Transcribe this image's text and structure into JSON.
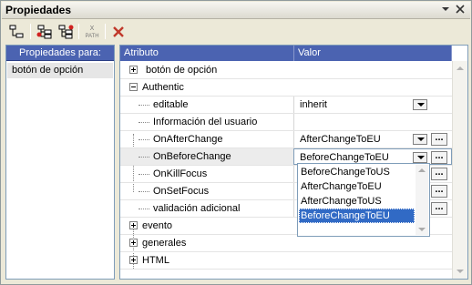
{
  "window": {
    "title": "Propiedades"
  },
  "left_panel": {
    "header": "Propiedades para:",
    "items": [
      "botón de opción"
    ]
  },
  "columns": {
    "attribute": "Atributo",
    "value": "Valor"
  },
  "rows": [
    {
      "label": "botón de opción",
      "expander": "plus"
    },
    {
      "label": "Authentic",
      "expander": "minus"
    },
    {
      "label": "editable",
      "value": "inherit"
    },
    {
      "label": "Información del usuario"
    },
    {
      "label": "OnAfterChange",
      "value": "AfterChangeToEU"
    },
    {
      "label": "OnBeforeChange",
      "value": "BeforeChangeToEU"
    },
    {
      "label": "OnKillFocus"
    },
    {
      "label": "OnSetFocus"
    },
    {
      "label": "validación adicional"
    },
    {
      "label": "evento",
      "expander": "plus"
    },
    {
      "label": "generales",
      "expander": "plus"
    },
    {
      "label": "HTML",
      "expander": "plus"
    }
  ],
  "more_label": "...",
  "dropdown": {
    "options": [
      "BeforeChangeToUS",
      "AfterChangeToEU",
      "AfterChangeToUS",
      "BeforeChangeToEU"
    ],
    "selected": "BeforeChangeToEU"
  },
  "colors": {
    "header_blue": "#4b63b1",
    "selection_blue": "#316ac5",
    "close_red": "#c0392b"
  },
  "icons": [
    "tree-view-icon",
    "add-before-icon",
    "add-after-icon",
    "xpath-icon",
    "delete-icon"
  ],
  "toolbar": {
    "xpath_label": "PATH"
  }
}
